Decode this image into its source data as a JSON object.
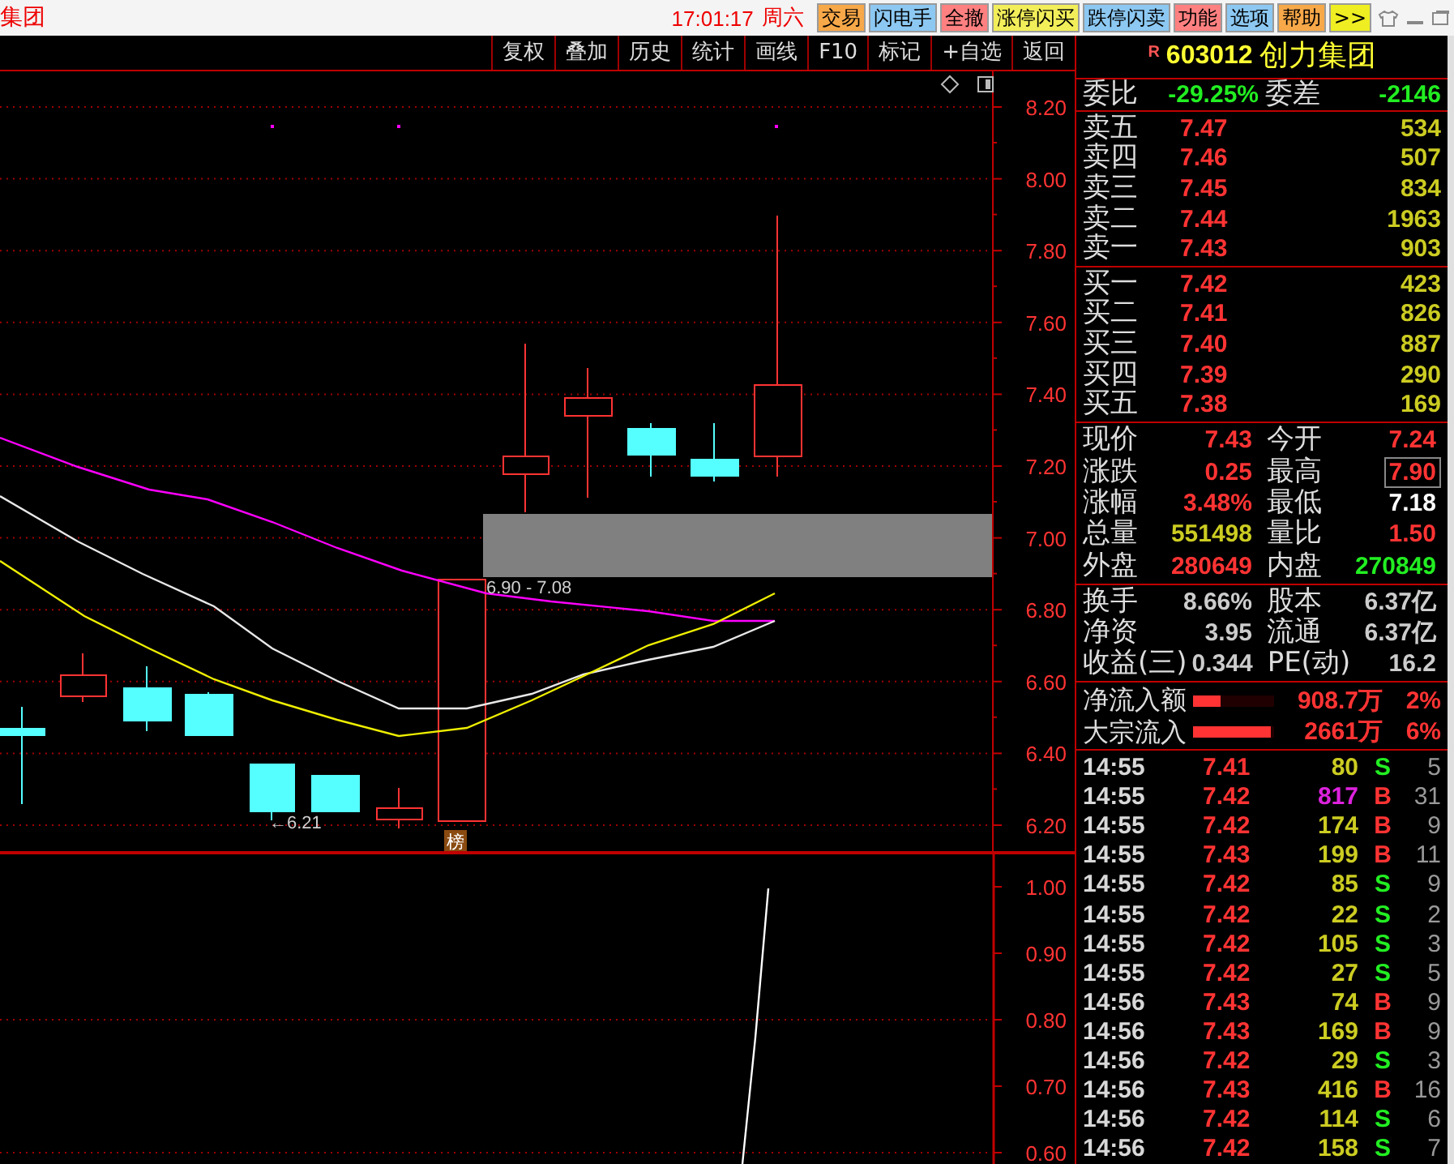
{
  "title_bar": {
    "window_title": "集团",
    "clock": "17:01:17",
    "weekday": "周六",
    "buttons": [
      {
        "label": "交易",
        "color": "#f7a848"
      },
      {
        "label": "闪电手",
        "color": "#8cc8f2"
      },
      {
        "label": "全撤",
        "color": "#ff8080"
      },
      {
        "label": "涨停闪买",
        "color": "#f2ee5a"
      },
      {
        "label": "跌停闪卖",
        "color": "#8cc8f2"
      },
      {
        "label": "功能",
        "color": "#ff8080"
      },
      {
        "label": "选项",
        "color": "#8cc8f2"
      },
      {
        "label": "帮助",
        "color": "#f7a848"
      },
      {
        "label": ">>",
        "color": "#eeee22"
      }
    ]
  },
  "toolbar": {
    "buttons": [
      "复权",
      "叠加",
      "历史",
      "统计",
      "画线",
      "F10",
      "标记",
      "+自选",
      "返回"
    ]
  },
  "main_chart": {
    "price_axis": [
      "8.20",
      "8.00",
      "7.80",
      "7.60",
      "7.40",
      "7.20",
      "7.00",
      "6.80",
      "6.60",
      "6.40",
      "6.20"
    ],
    "zone_label": "6.90 - 7.08",
    "low_label": "←6.21",
    "badge": "榜"
  },
  "indicator_chart": {
    "axis": [
      "1.00",
      "0.90",
      "0.80",
      "0.70",
      "0.60"
    ]
  },
  "quote": {
    "badge": "R",
    "code": "603012",
    "name": "创力集团",
    "ratio": {
      "label": "委比",
      "value": "-29.25%",
      "diff_label": "委差",
      "diff": "-2146"
    },
    "asks": [
      {
        "label": "卖五",
        "price": "7.47",
        "volume": "534"
      },
      {
        "label": "卖四",
        "price": "7.46",
        "volume": "507"
      },
      {
        "label": "卖三",
        "price": "7.45",
        "volume": "834"
      },
      {
        "label": "卖二",
        "price": "7.44",
        "volume": "1963"
      },
      {
        "label": "卖一",
        "price": "7.43",
        "volume": "903"
      }
    ],
    "bids": [
      {
        "label": "买一",
        "price": "7.42",
        "volume": "423"
      },
      {
        "label": "买二",
        "price": "7.41",
        "volume": "826"
      },
      {
        "label": "买三",
        "price": "7.40",
        "volume": "887"
      },
      {
        "label": "买四",
        "price": "7.39",
        "volume": "290"
      },
      {
        "label": "买五",
        "price": "7.38",
        "volume": "169"
      }
    ],
    "stats": [
      [
        {
          "label": "现价",
          "value": "7.43",
          "color": "#ff3333",
          "boxed": false
        },
        {
          "label": "今开",
          "value": "7.24",
          "color": "#ff3333",
          "boxed": false
        }
      ],
      [
        {
          "label": "涨跌",
          "value": "0.25",
          "color": "#ff3333",
          "boxed": false
        },
        {
          "label": "最高",
          "value": "7.90",
          "color": "#ff3333",
          "boxed": true
        }
      ],
      [
        {
          "label": "涨幅",
          "value": "3.48%",
          "color": "#ff3333",
          "boxed": false
        },
        {
          "label": "最低",
          "value": "7.18",
          "color": "#ffffff",
          "boxed": false
        }
      ],
      [
        {
          "label": "总量",
          "value": "551498",
          "color": "#cccc22",
          "boxed": false
        },
        {
          "label": "量比",
          "value": "1.50",
          "color": "#ff3333",
          "boxed": false
        }
      ],
      [
        {
          "label": "外盘",
          "value": "280649",
          "color": "#ff3333",
          "boxed": false
        },
        {
          "label": "内盘",
          "value": "270849",
          "color": "#22ee22",
          "boxed": false
        }
      ]
    ],
    "info": [
      [
        {
          "label": "换手",
          "value": "8.66%"
        },
        {
          "label": "股本",
          "value": "6.37亿"
        }
      ],
      [
        {
          "label": "净资",
          "value": "3.95"
        },
        {
          "label": "流通",
          "value": "6.37亿"
        }
      ],
      [
        {
          "label": "收益(三)",
          "value": "0.344"
        },
        {
          "label": "PE(动)",
          "value": "16.2"
        }
      ]
    ],
    "flows": [
      {
        "label": "净流入额",
        "level": 0.33,
        "amount": "908.7万",
        "percent": "2%"
      },
      {
        "label": "大宗流入",
        "level": 0.95,
        "amount": "2661万",
        "percent": "6%"
      }
    ],
    "ticks": [
      {
        "time": "14:55",
        "price": "7.41",
        "volume": "80",
        "side": "S",
        "kind": "sell",
        "large_order": false,
        "count": "5"
      },
      {
        "time": "14:55",
        "price": "7.42",
        "volume": "817",
        "side": "B",
        "kind": "buy",
        "large_order": true,
        "count": "31"
      },
      {
        "time": "14:55",
        "price": "7.42",
        "volume": "174",
        "side": "B",
        "kind": "buy",
        "large_order": false,
        "count": "9"
      },
      {
        "time": "14:55",
        "price": "7.43",
        "volume": "199",
        "side": "B",
        "kind": "buy",
        "large_order": false,
        "count": "11"
      },
      {
        "time": "14:55",
        "price": "7.42",
        "volume": "85",
        "side": "S",
        "kind": "sell",
        "large_order": false,
        "count": "9"
      },
      {
        "time": "14:55",
        "price": "7.42",
        "volume": "22",
        "side": "S",
        "kind": "sell",
        "large_order": false,
        "count": "2"
      },
      {
        "time": "14:55",
        "price": "7.42",
        "volume": "105",
        "side": "S",
        "kind": "sell",
        "large_order": false,
        "count": "3"
      },
      {
        "time": "14:55",
        "price": "7.42",
        "volume": "27",
        "side": "S",
        "kind": "sell",
        "large_order": false,
        "count": "5"
      },
      {
        "time": "14:56",
        "price": "7.43",
        "volume": "74",
        "side": "B",
        "kind": "buy",
        "large_order": false,
        "count": "9"
      },
      {
        "time": "14:56",
        "price": "7.43",
        "volume": "169",
        "side": "B",
        "kind": "buy",
        "large_order": false,
        "count": "9"
      },
      {
        "time": "14:56",
        "price": "7.42",
        "volume": "29",
        "side": "S",
        "kind": "sell",
        "large_order": false,
        "count": "3"
      },
      {
        "time": "14:56",
        "price": "7.43",
        "volume": "416",
        "side": "B",
        "kind": "buy",
        "large_order": false,
        "count": "16"
      },
      {
        "time": "14:56",
        "price": "7.42",
        "volume": "114",
        "side": "S",
        "kind": "sell",
        "large_order": false,
        "count": "6"
      },
      {
        "time": "14:56",
        "price": "7.42",
        "volume": "158",
        "side": "S",
        "kind": "sell",
        "large_order": false,
        "count": "7"
      }
    ]
  }
}
